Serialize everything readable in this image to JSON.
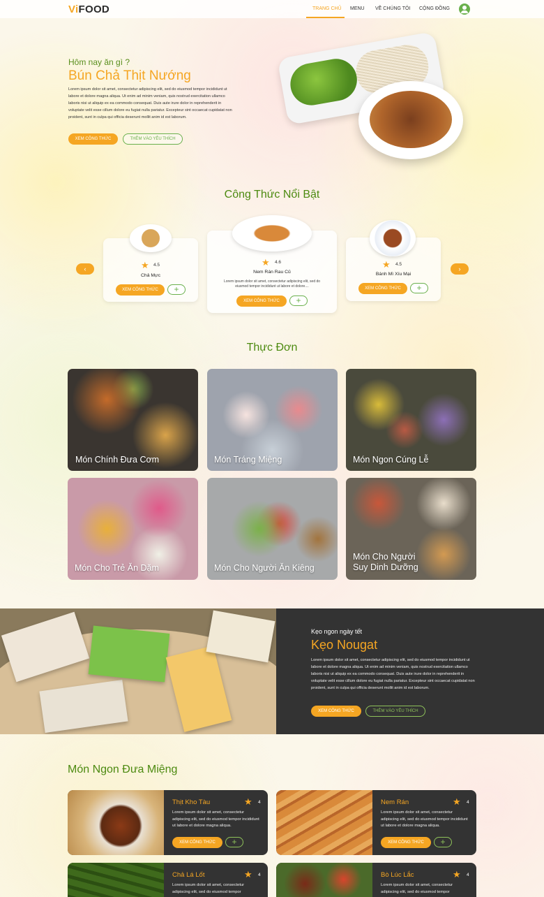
{
  "nav": {
    "logo_vi": "Vi",
    "logo_food": "FOOD",
    "items": [
      {
        "label": "TRANG CHỦ"
      },
      {
        "label": "MENU"
      },
      {
        "label": "VỀ CHÚNG TÔI"
      },
      {
        "label": "CỘNG ĐỒNG"
      }
    ],
    "active_index": 0
  },
  "hero": {
    "eyebrow": "Hôm nay ăn gì ?",
    "title": "Bún Chả Thịt Nướng",
    "text": "Lorem ipsum dolor sit amet, consectetur adipiscing elit, sed do eiusmod tempor incididunt ut labore et dolore magna aliqua. Ut enim ad minim veniam, quis nostrud exercitation ullamco laboris nisi ut aliquip ex ea commodo consequat. Duis aute irure dolor in reprehenderit in voluptate velit esse cillum dolore eu fugiat nulla pariatur. Excepteur sint occaecat cupidatat non proident, sunt in culpa qui officia deserunt mollit anim id est laborum.",
    "primary_button": "XEM CÔNG THỨC",
    "secondary_button": "THÊM VÀO YÊU THÍCH"
  },
  "featured": {
    "title": "Công Thức Nổi Bật",
    "prev_icon": "chevron-left-icon",
    "next_icon": "chevron-right-icon",
    "cards": [
      {
        "name": "Chả Mực",
        "rating": "4.5",
        "button": "XEM CÔNG THỨC",
        "plus": "+"
      },
      {
        "name": "Nem Rán Rau Củ",
        "rating": "4.6",
        "desc": "Lorem ipsum dolor sit amet, consectetur adipiscing elit, sed do eiusmod tempor incididunt ut labore et dolore....",
        "button": "XEM CÔNG THỨC",
        "plus": "+"
      },
      {
        "name": "Bánh Mì Xíu Mại",
        "rating": "4.5",
        "button": "XEM CÔNG THỨC",
        "plus": "+"
      }
    ]
  },
  "menu": {
    "title": "Thực Đơn",
    "tiles": [
      {
        "label": "Món Chính Đưa Cơm"
      },
      {
        "label": "Món Tráng Miệng"
      },
      {
        "label": "Món Ngon Cúng Lễ"
      },
      {
        "label": "Món Cho Trẻ Ăn Dặm"
      },
      {
        "label": "Món Cho Người Ăn Kiêng"
      },
      {
        "label_line1": "Món Cho Người",
        "label_line2": "Suy Dinh Dưỡng"
      }
    ]
  },
  "promo": {
    "eyebrow": "Kẹo ngon ngày tết",
    "title": "Kẹo Nougat",
    "text": "Lorem ipsum dolor sit amet, consectetur adipiscing elit, sed do eiusmod tempor incididunt ut labore et dolore magna aliqua. Ut enim ad minim veniam, quis nostrud exercitation ullamco laboris nisi ut aliquip ex ea commodo consequat. Duis aute irure dolor in reprehenderit in voluptate velit esse cillum dolore eu fugiat nulla pariatur. Excepteur sint occaecat cupidatat non proident, sunt in culpa qui officia deserunt mollit anim id est laborum.",
    "primary_button": "XEM CÔNG THỨC",
    "secondary_button": "THÊM VÀO YÊU THÍCH"
  },
  "dishes": {
    "title": "Món Ngon Đưa Miệng",
    "cards": [
      {
        "name": "Thịt Kho Tàu",
        "rating": "4",
        "text": "Lorem ipsum dolor sit amet, consectetur adipiscing elit, sed do eiusmod tempor incididunt ut labore et dolore magna aliqua.",
        "button": "XEM CÔNG THỨC",
        "plus": "+"
      },
      {
        "name": "Nem Rán",
        "rating": "4",
        "text": "Lorem ipsum dolor sit amet, consectetur adipiscing elit, sed do eiusmod tempor incididunt ut labore et dolore magna aliqua.",
        "button": "XEM CÔNG THỨC",
        "plus": "+"
      },
      {
        "name": "Chả Lá Lốt",
        "rating": "4",
        "text": "Lorem ipsum dolor sit amet, consectetur adipiscing elit, sed do eiusmod tempor"
      },
      {
        "name": "Bò Lúc Lắc",
        "rating": "4",
        "text": "Lorem ipsum dolor sit amet, consectetur adipiscing elit, sed do eiusmod tempor"
      }
    ]
  },
  "colors": {
    "accent": "#f5a623",
    "green": "#4c8a10",
    "dark_panel": "#333333"
  }
}
